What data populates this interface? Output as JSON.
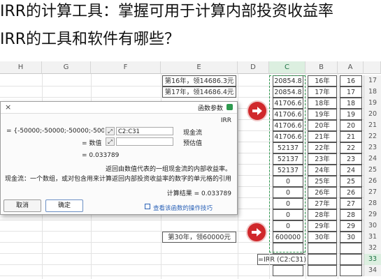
{
  "title": {
    "line1": "IRR的计算工具：掌握可用于计算内部投资收益率",
    "line2": "IRR的工具和软件有哪些？"
  },
  "sheet": {
    "columns": [
      "A",
      "B",
      "C",
      "D",
      "E",
      "F",
      "G",
      "H"
    ],
    "formula_bar_text": "=IRR (C2:C31)",
    "name_box": "IRR",
    "rows": [
      {
        "n": "17",
        "a": "16",
        "b": "16年",
        "c": "20854.8",
        "e": "第16年，领14686.3元"
      },
      {
        "n": "18",
        "a": "17",
        "b": "17年",
        "c": "20854.8",
        "e": "第17年，领14686.4元"
      },
      {
        "n": "19",
        "a": "18",
        "b": "18年",
        "c": "41706.6",
        "e": ""
      },
      {
        "n": "20",
        "a": "19",
        "b": "19年",
        "c": "41706.6",
        "e": ""
      },
      {
        "n": "21",
        "a": "20",
        "b": "20年",
        "c": "41706.6",
        "e": ""
      },
      {
        "n": "22",
        "a": "21",
        "b": "21年",
        "c": "41706.6",
        "e": ""
      },
      {
        "n": "23",
        "a": "22",
        "b": "22年",
        "c": "52137",
        "e": ""
      },
      {
        "n": "24",
        "a": "23",
        "b": "23年",
        "c": "52137",
        "e": ""
      },
      {
        "n": "25",
        "a": "24",
        "b": "24年",
        "c": "52137",
        "e": ""
      },
      {
        "n": "26",
        "a": "25",
        "b": "25年",
        "c": "0",
        "e": ""
      },
      {
        "n": "27",
        "a": "26",
        "b": "26年",
        "c": "0",
        "e": ""
      },
      {
        "n": "28",
        "a": "27",
        "b": "27年",
        "c": "0",
        "e": ""
      },
      {
        "n": "29",
        "a": "28",
        "b": "28年",
        "c": "0",
        "e": ""
      },
      {
        "n": "30",
        "a": "29",
        "b": "29年",
        "c": "0",
        "e": ""
      },
      {
        "n": "31",
        "a": "30",
        "b": "30年",
        "c": "600000",
        "e": "第30年，领60000元"
      },
      {
        "n": "32",
        "a": "",
        "b": "",
        "c": "",
        "e": ""
      },
      {
        "n": "33",
        "a": "",
        "b": "",
        "c": "=IRR (C2:C31)",
        "e": ""
      },
      {
        "n": "34",
        "a": "",
        "b": "",
        "c": "",
        "e": ""
      }
    ]
  },
  "dialog": {
    "title": "函数参数",
    "close_glyph": "×",
    "func_name": "IRR",
    "arg1_label": "现金流",
    "arg1_value": "C2:C31",
    "arg1_result": "= {-50000;-50000;-50000;-5000...",
    "arg2_label": "预估值",
    "arg2_result": "= 数值",
    "result_line": "= 0.033789",
    "desc1": "返回由数值代表的一组现金流的内部收益率。",
    "desc2": "现金流：一个数组，或对包含用来计算返回内部投资收益率的数字的单元格的引用",
    "calc_label": "计算结果 = 0.033789",
    "help_link": "查看该函数的操作技巧",
    "ok": "确定",
    "cancel": "取消"
  },
  "colors": {
    "selection": "#2e9a4f",
    "arrow": "#d0282b",
    "link": "#2b62b7"
  }
}
